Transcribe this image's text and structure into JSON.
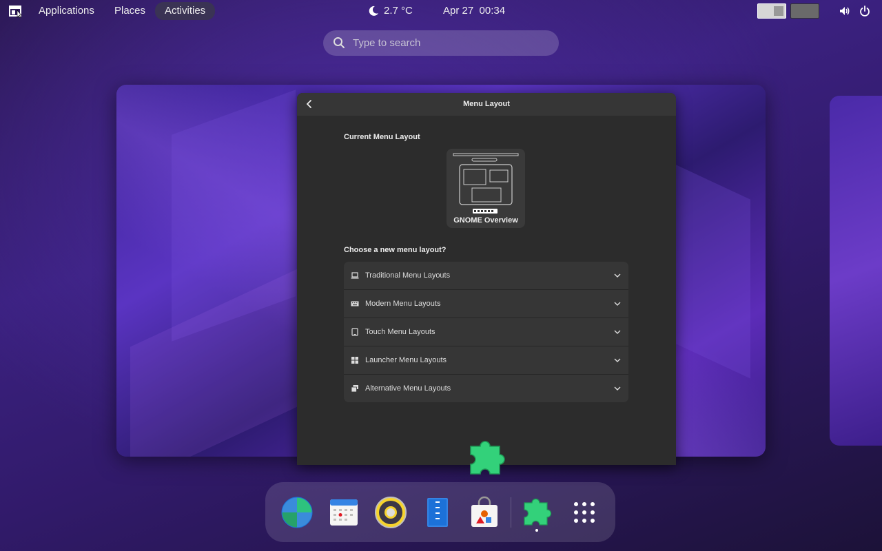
{
  "topbar": {
    "applications_label": "Applications",
    "places_label": "Places",
    "activities_label": "Activities",
    "weather": "2.7 °C",
    "datetime": "Apr 27  00:34",
    "icons": [
      "arcmenu-icon",
      "moon-icon",
      "volume-icon",
      "power-icon"
    ]
  },
  "search": {
    "placeholder": "Type to search"
  },
  "window": {
    "title": "Menu Layout",
    "current_label": "Current Menu Layout",
    "current_layout": "GNOME Overview",
    "choose_label": "Choose a new menu layout?",
    "categories": [
      {
        "label": "Traditional Menu Layouts",
        "icon": "laptop-icon"
      },
      {
        "label": "Modern Menu Layouts",
        "icon": "keyboard-icon"
      },
      {
        "label": "Touch Menu Layouts",
        "icon": "tablet-icon"
      },
      {
        "label": "Launcher Menu Layouts",
        "icon": "grid-icon"
      },
      {
        "label": "Alternative Menu Layouts",
        "icon": "windows-stack-icon"
      }
    ]
  },
  "dock": {
    "apps": [
      "web-browser-icon",
      "calendar-icon",
      "music-player-icon",
      "text-editor-icon",
      "software-store-icon",
      "extensions-icon",
      "show-apps-grid-icon"
    ]
  },
  "colors": {
    "accent_green": "#33d17a",
    "panel_bg": "#2c2c2c"
  }
}
